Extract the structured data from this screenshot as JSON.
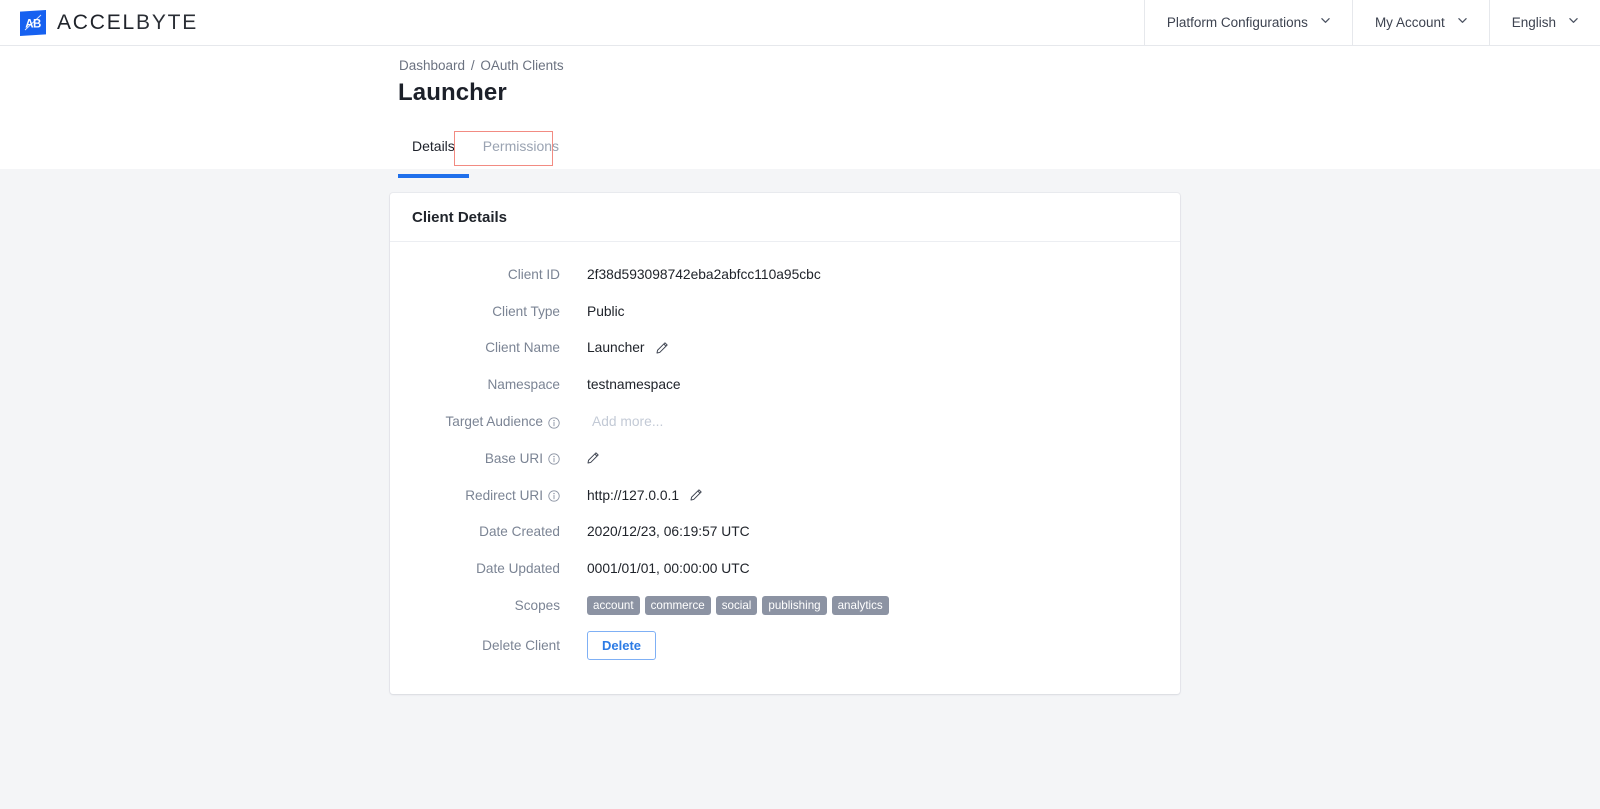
{
  "header": {
    "brand_name_bold": "ACCEL",
    "brand_name_light": "BYTE",
    "logo_icon": "accelbyte-logo-icon",
    "nav": [
      {
        "label": "Platform Configurations",
        "icon": "chevron-down-icon"
      },
      {
        "label": "My Account",
        "icon": "chevron-down-icon"
      },
      {
        "label": "English",
        "icon": "chevron-down-icon"
      }
    ]
  },
  "breadcrumb": {
    "items": [
      "Dashboard",
      "OAuth Clients"
    ],
    "separator": "/"
  },
  "page": {
    "title": "Launcher"
  },
  "tabs": [
    {
      "label": "Details",
      "active": true
    },
    {
      "label": "Permissions",
      "active": false,
      "annotated": true
    }
  ],
  "card": {
    "title": "Client Details",
    "rows": [
      {
        "label": "Client ID",
        "value": "2f38d593098742eba2abfcc110a95cbc",
        "info": false,
        "edit": false
      },
      {
        "label": "Client Type",
        "value": "Public",
        "info": false,
        "edit": false
      },
      {
        "label": "Client Name",
        "value": "Launcher",
        "info": false,
        "edit": true
      },
      {
        "label": "Namespace",
        "value": "testnamespace",
        "info": false,
        "edit": false
      },
      {
        "label": "Target Audience",
        "value": "",
        "placeholder": "Add more...",
        "info": true,
        "edit": false
      },
      {
        "label": "Base URI",
        "value": "",
        "info": true,
        "edit": true
      },
      {
        "label": "Redirect URI",
        "value": "http://127.0.0.1",
        "info": true,
        "edit": true
      },
      {
        "label": "Date Created",
        "value": "2020/12/23, 06:19:57 UTC",
        "info": false,
        "edit": false
      },
      {
        "label": "Date Updated",
        "value": "0001/01/01, 00:00:00 UTC",
        "info": false,
        "edit": false
      }
    ],
    "scopes_label": "Scopes",
    "scopes": [
      "account",
      "commerce",
      "social",
      "publishing",
      "analytics"
    ],
    "delete_label": "Delete Client",
    "delete_button": "Delete"
  },
  "colors": {
    "brand_blue": "#1761f0",
    "accent_blue": "#1f6feb",
    "link_blue": "#2c7be5",
    "annotation_red": "#f28b82",
    "badge_gray": "#8c93a3",
    "page_bg": "#f4f5f7",
    "label_gray": "#7b8494"
  }
}
